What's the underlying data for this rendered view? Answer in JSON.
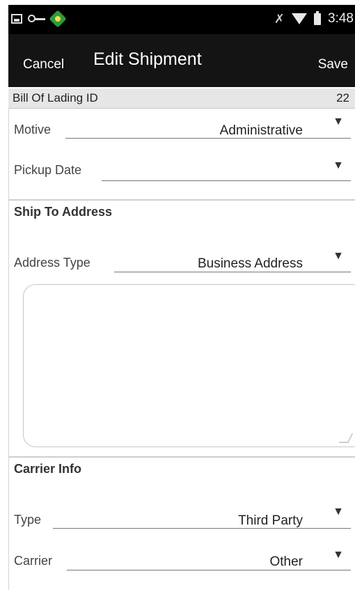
{
  "status_bar": {
    "time": "3:48"
  },
  "action_bar": {
    "cancel_label": "Cancel",
    "title": "Edit Shipment",
    "save_label": "Save"
  },
  "form": {
    "bill_of_lading": {
      "label": "Bill Of Lading ID",
      "value": "22"
    },
    "motive": {
      "label": "Motive",
      "value": "Administrative"
    },
    "pickup_date": {
      "label": "Pickup Date",
      "value": ""
    },
    "ship_to": {
      "section_title": "Ship To Address",
      "address_type": {
        "label": "Address Type",
        "value": "Business Address"
      },
      "address_text": ""
    },
    "carrier_info": {
      "section_title": "Carrier Info",
      "type": {
        "label": "Type",
        "value": "Third Party"
      },
      "carrier": {
        "label": "Carrier",
        "value": "Other"
      }
    }
  },
  "icons": [
    "picture-icon",
    "key-icon",
    "app-icon",
    "signal-icon",
    "wifi-icon",
    "battery-icon",
    "dropdown-arrow-icon"
  ]
}
